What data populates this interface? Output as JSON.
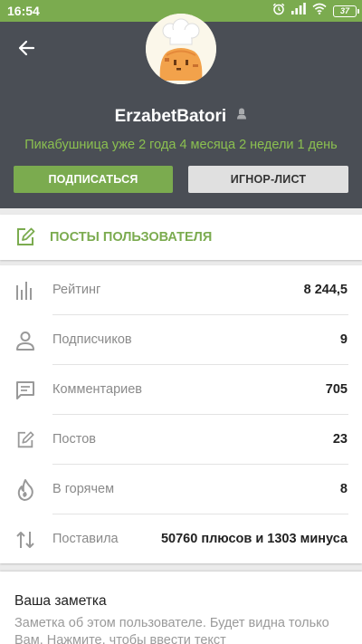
{
  "status_bar": {
    "time": "16:54",
    "battery": "37",
    "icons": [
      "alarm-icon",
      "signal-icon",
      "wifi-icon",
      "battery-icon"
    ]
  },
  "header": {
    "back_icon": "arrow-left-icon",
    "username": "ErzabetBatori",
    "gender_icon": "female-user-icon",
    "since": "Пикабушница уже 2 года 4 месяца 2 недели 1 день",
    "subscribe_label": "ПОДПИСАТЬСЯ",
    "ignore_label": "ИГНОР-ЛИСТ"
  },
  "posts_link": {
    "label": "ПОСТЫ ПОЛЬЗОВАТЕЛЯ",
    "icon": "edit-icon"
  },
  "stats": [
    {
      "icon": "bar-chart-icon",
      "label": "Рейтинг",
      "value": "8 244,5"
    },
    {
      "icon": "person-icon",
      "label": "Подписчиков",
      "value": "9"
    },
    {
      "icon": "comment-icon",
      "label": "Комментариев",
      "value": "705"
    },
    {
      "icon": "edit-icon",
      "label": "Постов",
      "value": "23"
    },
    {
      "icon": "flame-icon",
      "label": "В горячем",
      "value": "8"
    },
    {
      "icon": "swap-vertical-icon",
      "label": "Поставила",
      "value": "50760 плюсов и 1303 минуса"
    }
  ],
  "note": {
    "title": "Ваша заметка",
    "placeholder": "Заметка об этом пользователе. Будет видна только Вам. Нажмите, чтобы ввести текст"
  },
  "colors": {
    "accent": "#7bab4f",
    "header_bg": "#4a4e55",
    "since_text": "#8bc050"
  }
}
